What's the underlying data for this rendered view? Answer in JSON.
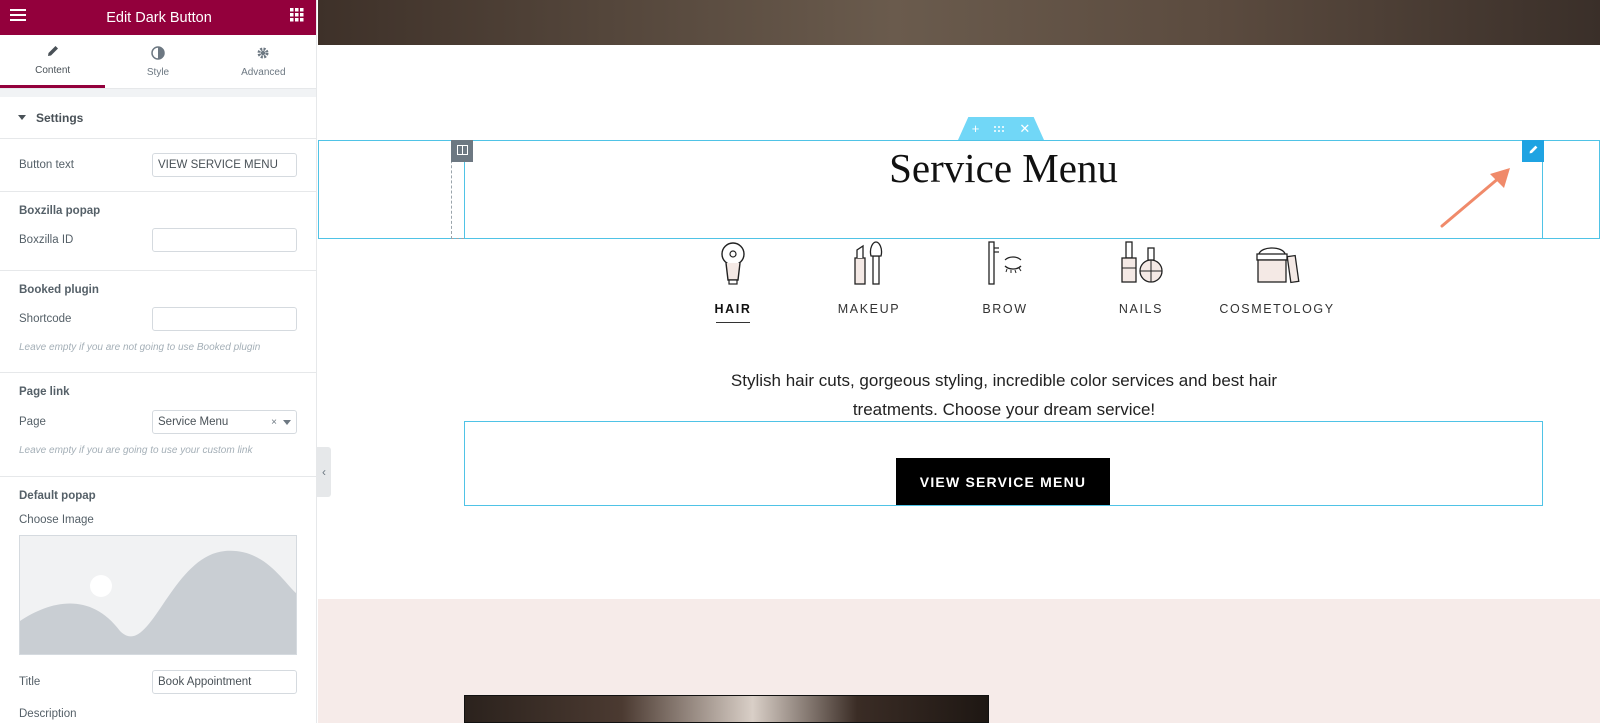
{
  "editor": {
    "header": {
      "title": "Edit Dark Button"
    },
    "tabs": [
      {
        "label": "Content",
        "active": true
      },
      {
        "label": "Style",
        "active": false
      },
      {
        "label": "Advanced",
        "active": false
      }
    ],
    "section": {
      "label": "Settings"
    },
    "button_text": {
      "label": "Button text",
      "value": "VIEW SERVICE MENU"
    },
    "boxzilla": {
      "title": "Boxzilla popap",
      "id_label": "Boxzilla ID",
      "id_value": ""
    },
    "booked": {
      "title": "Booked plugin",
      "shortcode_label": "Shortcode",
      "shortcode_value": "",
      "note": "Leave empty if you are not going to use Booked plugin"
    },
    "page_link": {
      "title": "Page link",
      "page_label": "Page",
      "page_value": "Service Menu",
      "clear": "×",
      "note": "Leave empty if you are going to use your custom link"
    },
    "default_popap": {
      "title": "Default popap",
      "choose_image": "Choose Image",
      "title_label": "Title",
      "title_value": "Book Appointment",
      "description_label": "Description"
    }
  },
  "page": {
    "heading": "Service Menu",
    "categories": [
      {
        "label": "HAIR",
        "icon": "hair-dryer-icon",
        "active": true
      },
      {
        "label": "MAKEUP",
        "icon": "makeup-brush-icon",
        "active": false
      },
      {
        "label": "BROW",
        "icon": "brow-icon",
        "active": false
      },
      {
        "label": "NAILS",
        "icon": "nail-polish-icon",
        "active": false
      },
      {
        "label": "COSMETOLOGY",
        "icon": "cream-jar-icon",
        "active": false
      }
    ],
    "description": "Stylish hair cuts, gorgeous styling, incredible color services and best hair treatments. Choose your dream service!",
    "cta_label": "VIEW SERVICE MENU"
  },
  "colors": {
    "editor_header": "#93003c",
    "selection_outline": "#4fc3e6",
    "edit_handle": "#1fa3e2",
    "annotation_arrow": "#f08a6a",
    "pink_section": "#f6ebe9"
  }
}
